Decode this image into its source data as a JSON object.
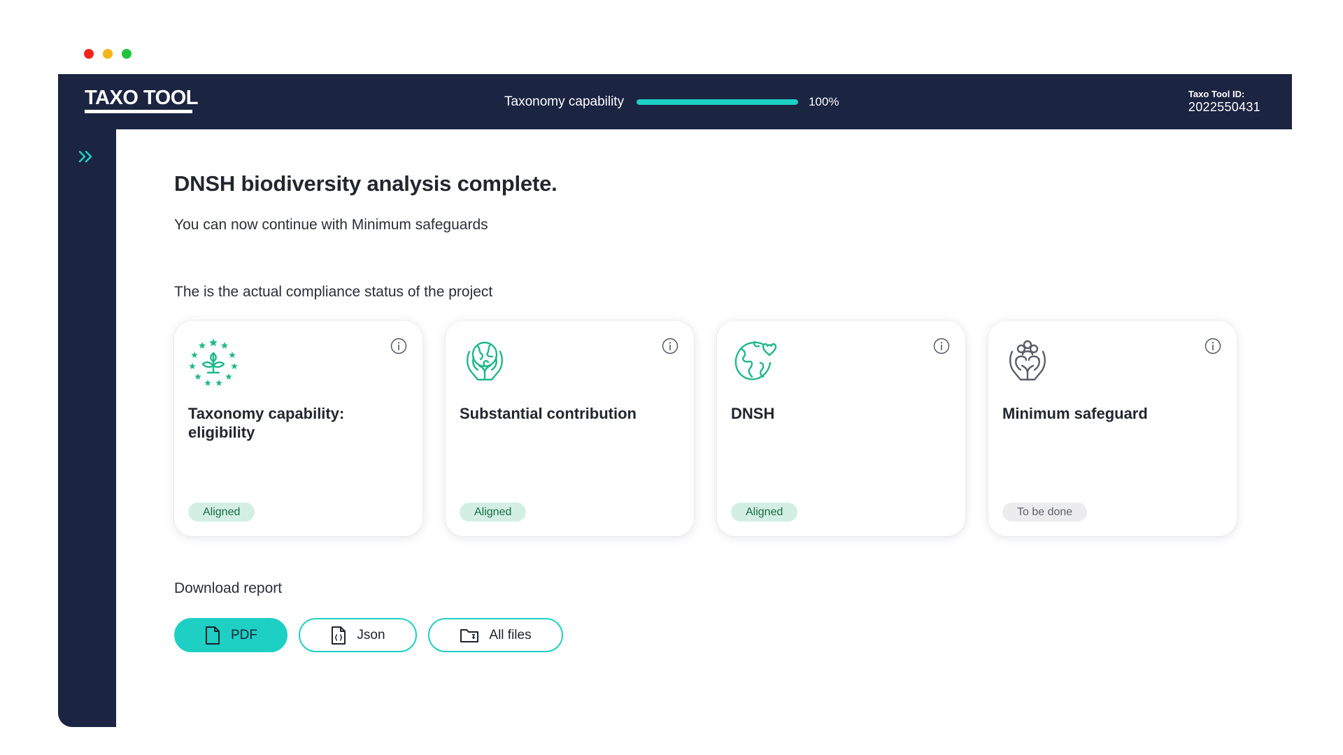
{
  "app": {
    "logo": "TAXO TOOL",
    "progress": {
      "label": "Taxonomy capability",
      "value_text": "100%",
      "fraction": 1.0
    },
    "tool_id": {
      "label": "Taxo Tool ID:",
      "value": "2022550431"
    }
  },
  "colors": {
    "navy": "#1b2441",
    "accent": "#1ecfc4",
    "icon_green": "#1fb887",
    "aligned_bg": "#d3efe3",
    "aligned_text": "#176c48",
    "todo_bg": "#ececef"
  },
  "sidebar": {
    "expand_icon": "double-chevron-right-icon"
  },
  "main": {
    "heading": "DNSH biodiversity analysis complete.",
    "subheading": "You can now continue with Minimum safeguards",
    "status_intro": "The is the actual compliance status of the project",
    "cards": [
      {
        "title": "Taxonomy capability: eligibility",
        "icon": "eu-stars-sprout-icon",
        "status": "Aligned"
      },
      {
        "title": "Substantial contribution",
        "icon": "hands-globe-icon",
        "status": "Aligned"
      },
      {
        "title": "DNSH",
        "icon": "globe-heart-icon",
        "status": "Aligned"
      },
      {
        "title": "Minimum safeguard",
        "icon": "hands-people-icon",
        "status": "To be done"
      }
    ],
    "download": {
      "label": "Download report",
      "buttons": [
        {
          "label": "PDF",
          "icon": "file-icon"
        },
        {
          "label": "Json",
          "icon": "json-file-icon"
        },
        {
          "label": "All files",
          "icon": "folder-icon"
        }
      ]
    }
  }
}
